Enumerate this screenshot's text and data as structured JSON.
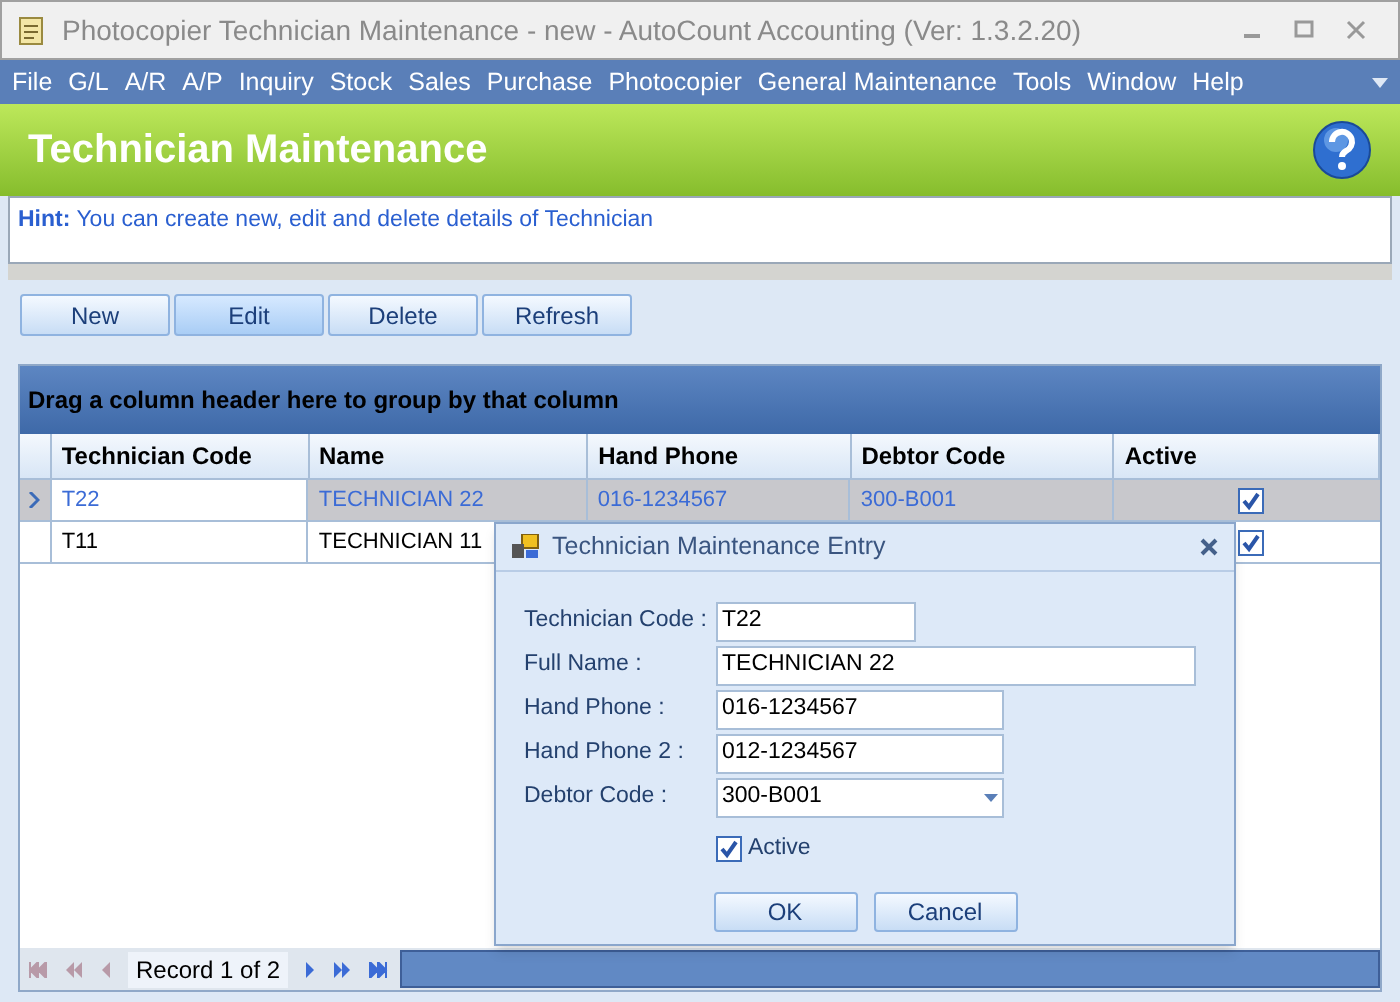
{
  "window": {
    "title": "Photocopier Technician Maintenance - new - AutoCount Accounting (Ver: 1.3.2.20)"
  },
  "menu": [
    "File",
    "G/L",
    "A/R",
    "A/P",
    "Inquiry",
    "Stock",
    "Sales",
    "Purchase",
    "Photocopier",
    "General Maintenance",
    "Tools",
    "Window",
    "Help"
  ],
  "header": {
    "title": "Technician Maintenance"
  },
  "hint": {
    "label": "Hint:",
    "text": "You can create new, edit and delete details of Technician"
  },
  "toolbar": [
    {
      "label": "New",
      "selected": false
    },
    {
      "label": "Edit",
      "selected": true
    },
    {
      "label": "Delete",
      "selected": false
    },
    {
      "label": "Refresh",
      "selected": false
    }
  ],
  "grid": {
    "group_hint": "Drag a column header here to group by that column",
    "columns": [
      "Technician Code",
      "Name",
      "Hand Phone",
      "Debtor Code",
      "Active"
    ],
    "rows": [
      {
        "selected": true,
        "cells": [
          "T22",
          "TECHNICIAN 22",
          "016-1234567",
          "300-B001"
        ],
        "active": true
      },
      {
        "selected": false,
        "cells": [
          "T11",
          "TECHNICIAN 11",
          "",
          ""
        ],
        "active": true
      }
    ]
  },
  "navigator": {
    "record": "Record 1 of 2"
  },
  "dialog": {
    "title": "Technician Maintenance Entry",
    "fields": [
      {
        "label": "Technician Code :",
        "value": "T22",
        "kind": "short"
      },
      {
        "label": "Full Name :",
        "value": "TECHNICIAN 22",
        "kind": "long"
      },
      {
        "label": "Hand Phone :",
        "value": "016-1234567",
        "kind": "medium"
      },
      {
        "label": "Hand Phone 2 :",
        "value": "012-1234567",
        "kind": "medium"
      },
      {
        "label": "Debtor Code :",
        "value": "300-B001",
        "kind": "dropdown"
      }
    ],
    "active": {
      "label": "Active",
      "checked": true
    },
    "buttons": [
      "OK",
      "Cancel"
    ]
  }
}
